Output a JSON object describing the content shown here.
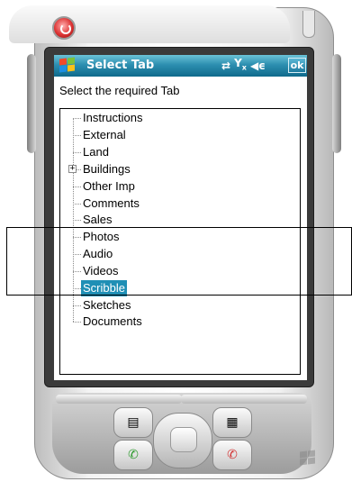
{
  "window": {
    "title": "Select Tab",
    "ok_label": "ok",
    "status_icons": [
      "connectivity-icon",
      "signal-off-icon",
      "volume-icon"
    ]
  },
  "main": {
    "instruction": "Select the required Tab"
  },
  "tree": {
    "items": [
      {
        "label": "Instructions",
        "expandable": false,
        "selected": false
      },
      {
        "label": "External",
        "expandable": false,
        "selected": false
      },
      {
        "label": "Land",
        "expandable": false,
        "selected": false
      },
      {
        "label": "Buildings",
        "expandable": true,
        "selected": false
      },
      {
        "label": "Other Imp",
        "expandable": false,
        "selected": false
      },
      {
        "label": "Comments",
        "expandable": false,
        "selected": false
      },
      {
        "label": "Sales",
        "expandable": false,
        "selected": false
      },
      {
        "label": "Photos",
        "expandable": false,
        "selected": false
      },
      {
        "label": "Audio",
        "expandable": false,
        "selected": false
      },
      {
        "label": "Videos",
        "expandable": false,
        "selected": false
      },
      {
        "label": "Scribble",
        "expandable": false,
        "selected": true
      },
      {
        "label": "Sketches",
        "expandable": false,
        "selected": false
      },
      {
        "label": "Documents",
        "expandable": false,
        "selected": false
      }
    ],
    "expander_symbol": "+"
  },
  "device": {
    "hardware_icons": [
      "calendar-icon",
      "contacts-icon",
      "call-icon",
      "end-call-icon",
      "windows-logo-icon"
    ]
  },
  "colors": {
    "titlebar": "#1e7fa4",
    "selection": "#1f8fb5",
    "power_button": "#d33333"
  }
}
